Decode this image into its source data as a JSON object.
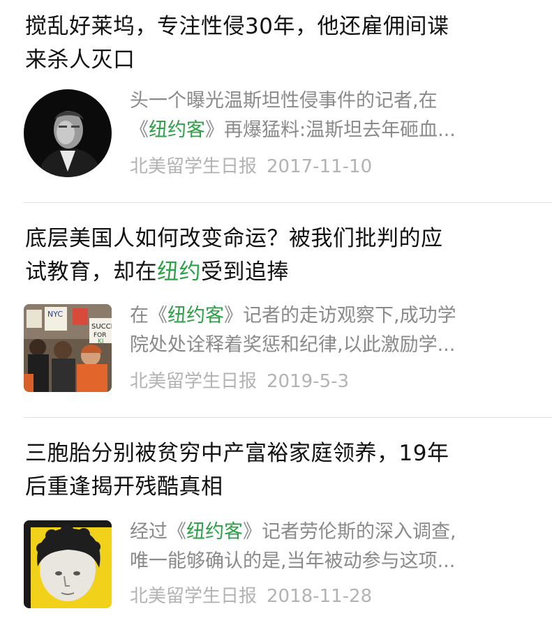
{
  "accent_color": "#2ba245",
  "articles": [
    {
      "title_parts": [
        "搅乱好莱坞，专注性侵30年，他还雇佣间谍",
        "来杀人灭口"
      ],
      "digest_line1": "头一个曝光温斯坦性侵事件的记者,在",
      "digest_line2": {
        "pre": "《",
        "hl": "纽约客",
        "post": "》再爆猛料:温斯坦去年砸血..."
      },
      "source": "北美留学生日报",
      "date": "2017-11-10",
      "thumb_icon": "portrait-man-photo-icon"
    },
    {
      "title_line1": "底层美国人如何改变命运？被我们批判的应",
      "title_line2": {
        "pre": "试教育，却在",
        "hl": "纽约",
        "post": "受到追捧"
      },
      "digest_line1": {
        "pre": "在《",
        "hl": "纽约客",
        "post": "》记者的走访观察下,成功学"
      },
      "digest_line2": "院处处诠释着奖惩和纪律,以此激励学...",
      "source": "北美留学生日报",
      "date": "2019-5-3",
      "thumb_icon": "protest-crowd-photo-icon",
      "thumb_sign_texts": [
        "NYC",
        "SUCCE",
        "FOR",
        "KI"
      ]
    },
    {
      "title_parts": [
        "三胞胎分别被贫穷中产富裕家庭领养，19年",
        "后重逢揭开残酷真相"
      ],
      "digest_line1": {
        "pre": "经过《",
        "hl": "纽约客",
        "post": "》记者劳伦斯的深入调查,"
      },
      "digest_line2": "唯一能够确认的是,当年被动参与这项...",
      "source": "北美留学生日报",
      "date": "2018-11-28",
      "thumb_icon": "curly-hair-boy-portrait-icon"
    }
  ]
}
